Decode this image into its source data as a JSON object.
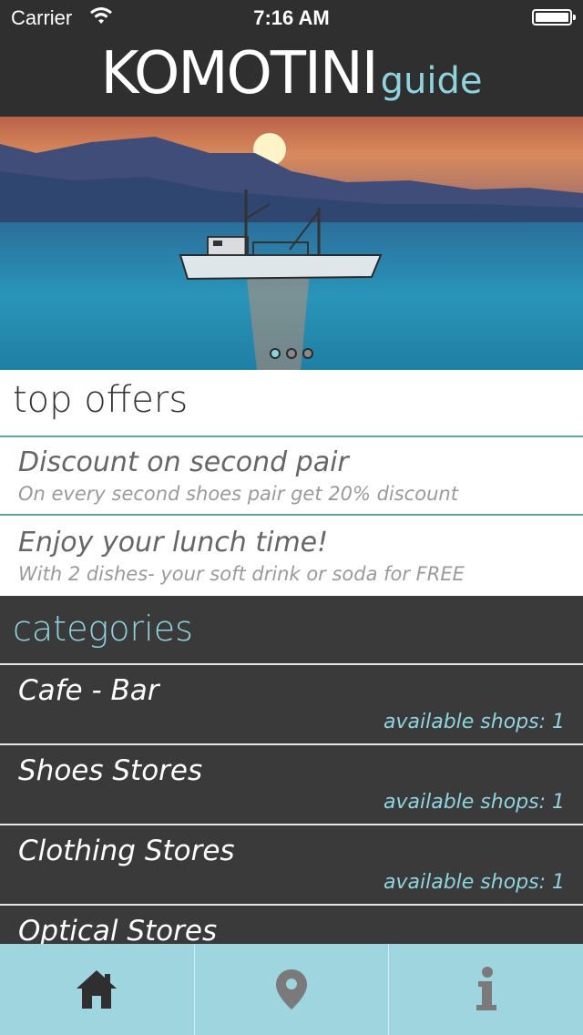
{
  "status_bar": {
    "carrier": "Carrier",
    "time": "7:16 AM"
  },
  "header": {
    "logo_main": "KOMOTINI",
    "logo_sub": "guide"
  },
  "hero": {
    "pages": 3,
    "active_page": 1
  },
  "top_offers": {
    "title": "top offers",
    "items": [
      {
        "title": "Discount on second pair",
        "description": "On every second shoes pair get 20% discount"
      },
      {
        "title": "Enjoy your lunch time!",
        "description": "With 2 dishes- your soft drink or soda for FREE"
      }
    ]
  },
  "categories": {
    "title": "categories",
    "items": [
      {
        "name": "Cafe - Bar",
        "count": "available shops: 1"
      },
      {
        "name": "Shoes Stores",
        "count": "available shops: 1"
      },
      {
        "name": "Clothing Stores",
        "count": "available shops: 1"
      },
      {
        "name": "Optical Stores",
        "count": ""
      }
    ]
  },
  "tabs": [
    {
      "icon": "home-icon"
    },
    {
      "icon": "map-pin-icon"
    },
    {
      "icon": "info-icon"
    }
  ],
  "colors": {
    "accent": "#8fd3df",
    "dark": "#3a3a3a",
    "tabbar": "#9ed5df"
  }
}
